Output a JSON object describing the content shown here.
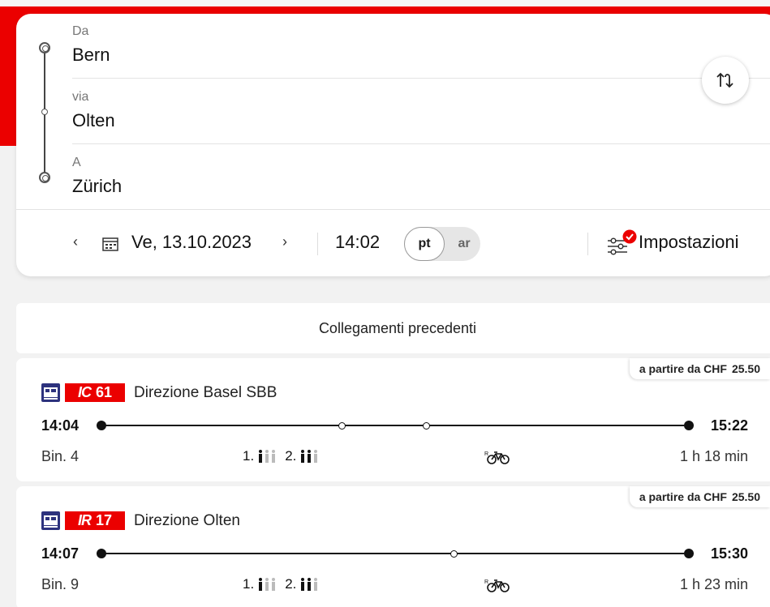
{
  "search": {
    "from_label": "Da",
    "from_value": "Bern",
    "via_label": "via",
    "via_value": "Olten",
    "to_label": "A",
    "to_value": "Zürich",
    "date_prev": "‹",
    "date": "Ve, 13.10.2023",
    "date_next": "›",
    "time": "14:02",
    "toggle_departure": "pt",
    "toggle_arrival": "ar",
    "settings_label": "Impostazioni"
  },
  "previous_connections": "Collegamenti precedenti",
  "connections": [
    {
      "price_prefix": "a partire da CHF",
      "price": "25.50",
      "product": "IC",
      "line_number": "61",
      "direction": "Direzione Basel SBB",
      "departure": "14:04",
      "arrival": "15:22",
      "platform": "Bin. 4",
      "first_class": "1.",
      "second_class": "2.",
      "duration": "1 h 18 min"
    },
    {
      "price_prefix": "a partire da CHF",
      "price": "25.50",
      "product": "IR",
      "line_number": "17",
      "direction": "Direzione Olten",
      "departure": "14:07",
      "arrival": "15:30",
      "platform": "Bin. 9",
      "first_class": "1.",
      "second_class": "2.",
      "duration": "1 h 23 min"
    }
  ],
  "colors": {
    "brand_red": "#eb0000",
    "train_blue": "#2d327d"
  }
}
